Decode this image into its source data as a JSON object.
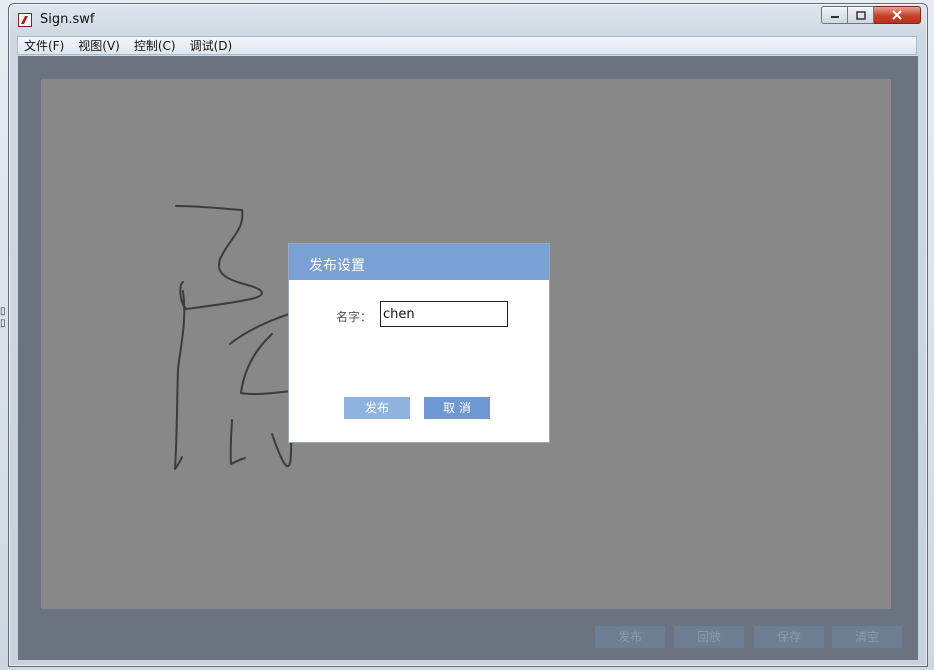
{
  "window": {
    "title": "Sign.swf"
  },
  "menu": {
    "items": [
      "文件(F)",
      "视图(V)",
      "控制(C)",
      "调试(D)"
    ]
  },
  "bottom_buttons": [
    "发布",
    "回放",
    "保存",
    "清空"
  ],
  "dialog": {
    "title": "发布设置",
    "name_label": "名字：",
    "name_value": "chen",
    "publish_label": "发布",
    "cancel_label": "取 消"
  },
  "colors": {
    "dialog_header": "#7aa0d6",
    "canvas": "#888888",
    "client_bg": "#6a737f"
  }
}
